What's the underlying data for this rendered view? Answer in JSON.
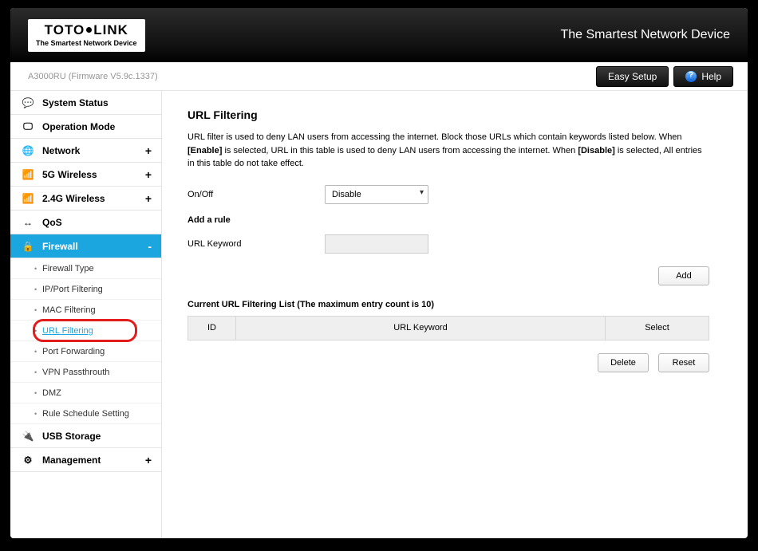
{
  "header": {
    "logo_left": "TOTO",
    "logo_right": "LINK",
    "logo_sub": "The Smartest Network Device",
    "tagline": "The Smartest Network Device"
  },
  "infobar": {
    "model": "A3000RU (Firmware V5.9c.1337)",
    "easy_setup": "Easy Setup",
    "help": "Help"
  },
  "sidebar": {
    "items": [
      {
        "icon": "💬",
        "label": "System Status",
        "exp": ""
      },
      {
        "icon": "🖵",
        "label": "Operation Mode",
        "exp": ""
      },
      {
        "icon": "🌐",
        "label": "Network",
        "exp": "+"
      },
      {
        "icon": "📶",
        "label": "5G Wireless",
        "exp": "+"
      },
      {
        "icon": "📶",
        "label": "2.4G Wireless",
        "exp": "+"
      },
      {
        "icon": "↔",
        "label": "QoS",
        "exp": ""
      },
      {
        "icon": "🔒",
        "label": "Firewall",
        "exp": "-"
      },
      {
        "icon": "🔌",
        "label": "USB Storage",
        "exp": ""
      },
      {
        "icon": "⚙",
        "label": "Management",
        "exp": "+"
      }
    ],
    "firewall_sub": [
      "Firewall Type",
      "IP/Port Filtering",
      "MAC Filtering",
      "URL Filtering",
      "Port Forwarding",
      "VPN Passthrouth",
      "DMZ",
      "Rule Schedule Setting"
    ]
  },
  "main": {
    "title": "URL Filtering",
    "desc_p1": "URL filter is used to deny LAN users from accessing the internet. Block those URLs which contain keywords listed below. When ",
    "desc_b1": "[Enable]",
    "desc_p2": " is selected, URL in this table is used to deny LAN users from accessing the internet. When ",
    "desc_b2": "[Disable]",
    "desc_p3": " is selected, All entries in this table do not take effect.",
    "onoff_label": "On/Off",
    "onoff_value": "Disable",
    "add_rule_h": "Add a rule",
    "url_keyword_label": "URL Keyword",
    "url_keyword_value": "",
    "add_btn": "Add",
    "list_title": "Current URL Filtering List  (The maximum entry count is 10)",
    "th_id": "ID",
    "th_kw": "URL Keyword",
    "th_sel": "Select",
    "delete_btn": "Delete",
    "reset_btn": "Reset"
  }
}
